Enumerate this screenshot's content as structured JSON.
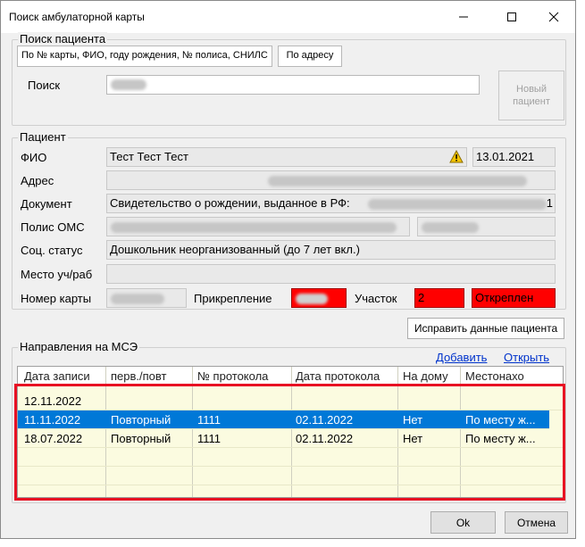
{
  "window": {
    "title": "Поиск амбулаторной карты"
  },
  "search": {
    "group_title": "Поиск пациента",
    "tabs": [
      {
        "label": "По № карты, ФИО, году рождения, № полиса, СНИЛС"
      },
      {
        "label": "По адресу"
      }
    ],
    "search_label": "Поиск",
    "new_patient_label": "Новый пациент"
  },
  "patient": {
    "group_title": "Пациент",
    "fio_label": "ФИО",
    "fio_value": "Тест Тест Тест",
    "birth_date": "13.01.2021",
    "address_label": "Адрес",
    "document_label": "Документ",
    "document_value": "Свидетельство о рождении, выданное в РФ:",
    "document_suffix": "1",
    "oms_label": "Полис ОМС",
    "social_label": "Соц. статус",
    "social_value": "Дошкольник неорганизованный (до 7 лет вкл.)",
    "work_label": "Место уч/раб",
    "card_label": "Номер карты",
    "attach_label": "Прикрепление",
    "district_label": "Участок",
    "district_value": "2",
    "status_value": "Откреплен",
    "fix_button": "Исправить данные пациента"
  },
  "mse": {
    "group_title": "Направления на МСЭ",
    "add_link": "Добавить",
    "open_link": "Открыть",
    "columns": [
      "Дата записи",
      "перв./повт",
      "№ протокола",
      "Дата протокола",
      "На дому",
      "Местонахо"
    ],
    "rows": [
      [
        "12.11.2022",
        "",
        "",
        "",
        "",
        ""
      ],
      [
        "11.11.2022",
        "Повторный",
        "1111",
        "02.11.2022",
        "Нет",
        "По месту ж..."
      ],
      [
        "18.07.2022",
        "Повторный",
        "1111",
        "02.11.2022",
        "Нет",
        "По месту ж..."
      ]
    ],
    "selected_row": 1
  },
  "footer": {
    "ok_label": "Ok",
    "cancel_label": "Отмена"
  },
  "colors": {
    "accent": "#0078d7",
    "alert": "#ff0000",
    "highlight": "#e81123"
  }
}
